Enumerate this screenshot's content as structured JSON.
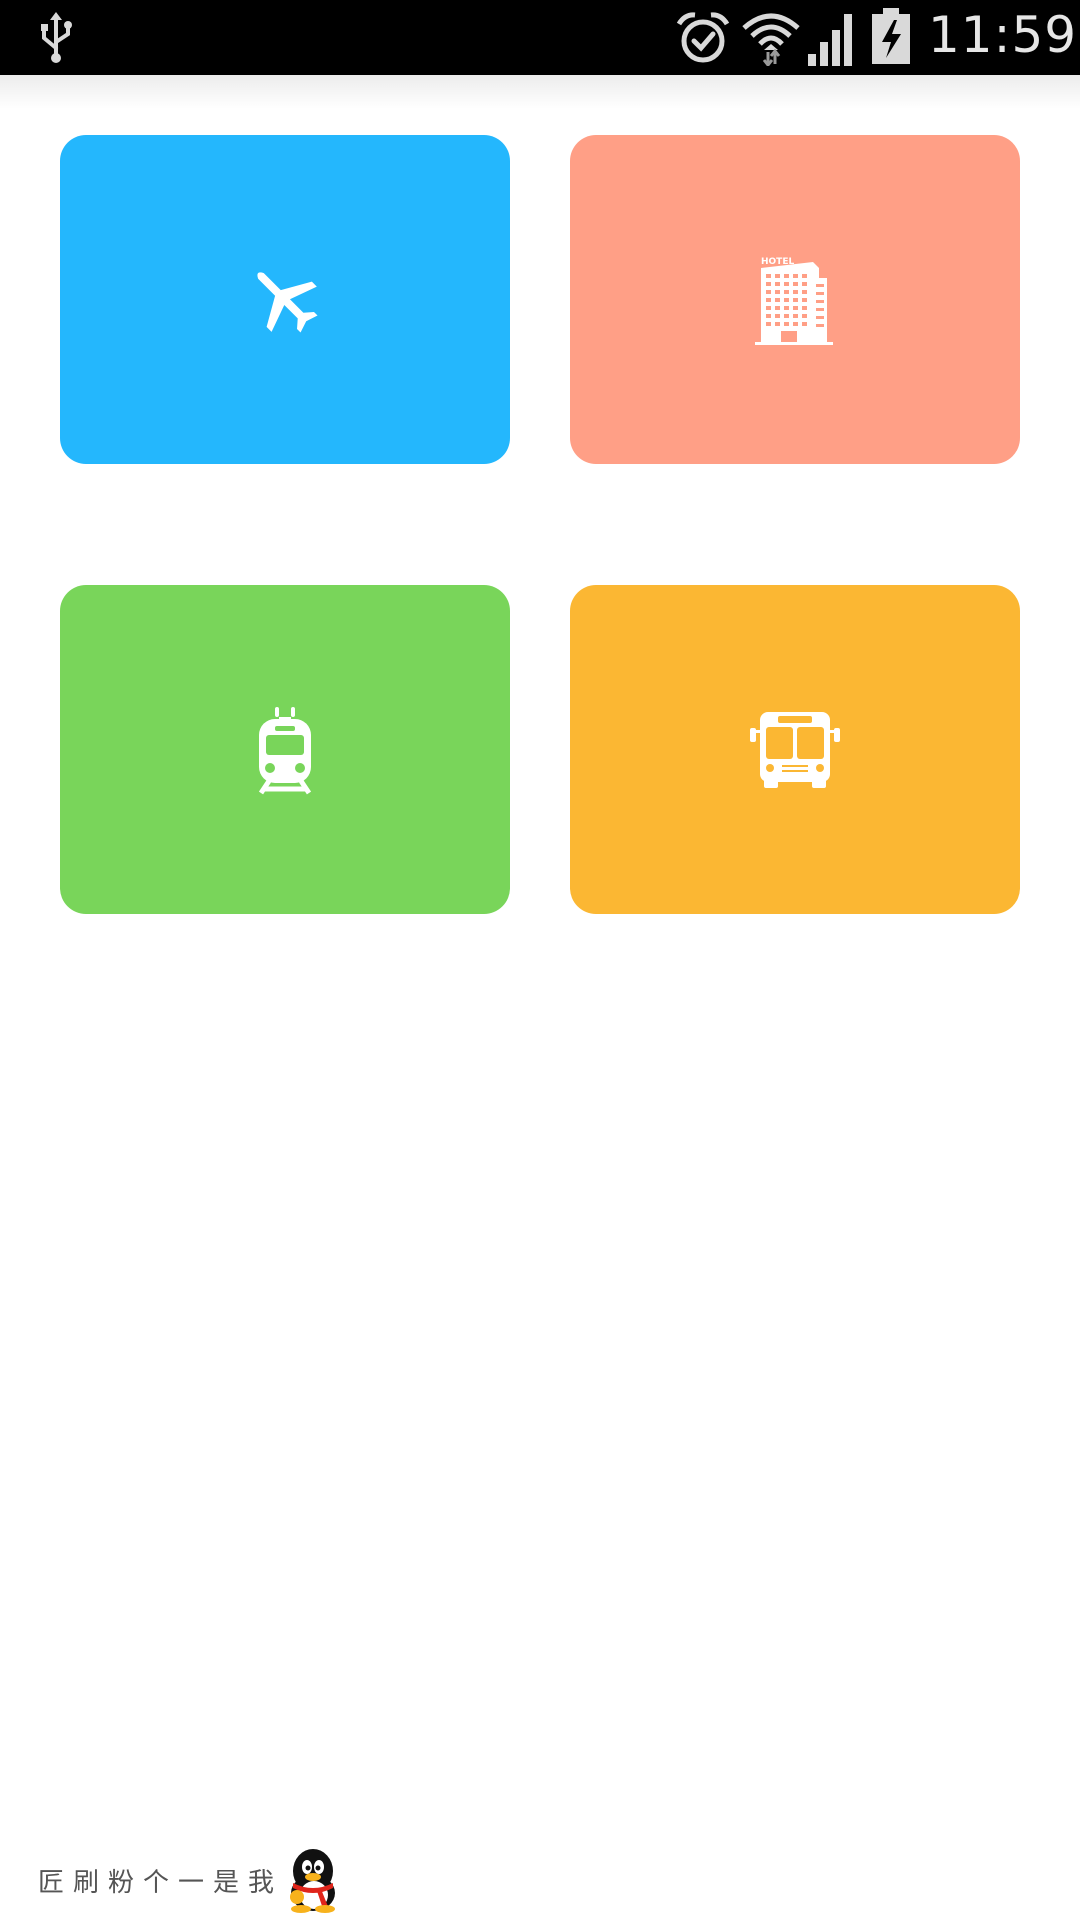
{
  "status_bar": {
    "time": "11:59",
    "icons": [
      "usb-icon",
      "alarm-icon",
      "wifi-icon",
      "signal-icon",
      "battery-charging-icon"
    ]
  },
  "tiles": [
    {
      "icon": "airplane-icon",
      "color": "#24b7fd"
    },
    {
      "icon": "hotel-icon",
      "color": "#ff9f86",
      "sign_text": "HOTEL"
    },
    {
      "icon": "train-icon",
      "color": "#79d55a"
    },
    {
      "icon": "bus-icon",
      "color": "#fbb733"
    }
  ],
  "footer": {
    "text": "匠刷粉个一是我",
    "icon": "qq-penguin-icon"
  }
}
